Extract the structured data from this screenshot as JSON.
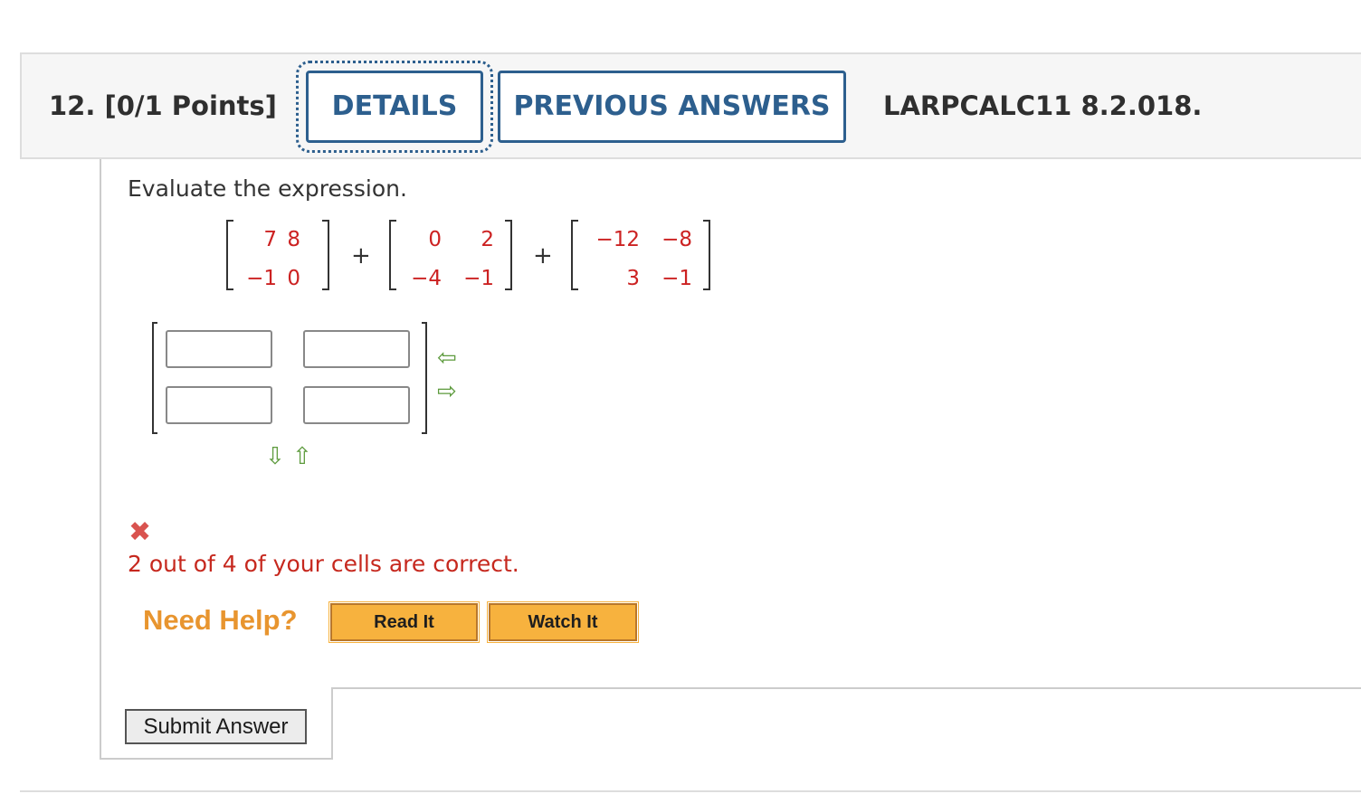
{
  "question": {
    "number_points": "12.  [0/1 Points]",
    "details_label": "DETAILS",
    "previous_answers_label": "PREVIOUS ANSWERS",
    "code": "LARPCALC11 8.2.018."
  },
  "prompt": "Evaluate the expression.",
  "matrices": [
    {
      "r1c1": "7",
      "r1c2": "8",
      "r2c1": "−1",
      "r2c2": "0"
    },
    {
      "r1c1": "0",
      "r1c2": "2",
      "r2c1": "−4",
      "r2c2": "−1"
    },
    {
      "r1c1": "−12",
      "r1c2": "−8",
      "r2c1": "3",
      "r2c2": "−1"
    }
  ],
  "operators": {
    "plus1": "+",
    "plus2": "+"
  },
  "answer_grid": {
    "values": [
      "",
      "",
      "",
      ""
    ],
    "arrow_icons": [
      "arrow-left-icon",
      "arrow-right-icon",
      "arrow-down-icon",
      "arrow-up-icon"
    ]
  },
  "feedback": {
    "icon": "x-mark-icon",
    "icon_color": "#d9534f",
    "text": "2 out of 4 of your cells are correct."
  },
  "help": {
    "label": "Need Help?",
    "read_it": "Read It",
    "watch_it": "Watch It"
  },
  "submit_label": "Submit Answer",
  "colors": {
    "accent": "#2d5f8e",
    "matrix_values": "#cc2222",
    "help_orange": "#e8952f",
    "button_orange": "#f7b23e"
  }
}
